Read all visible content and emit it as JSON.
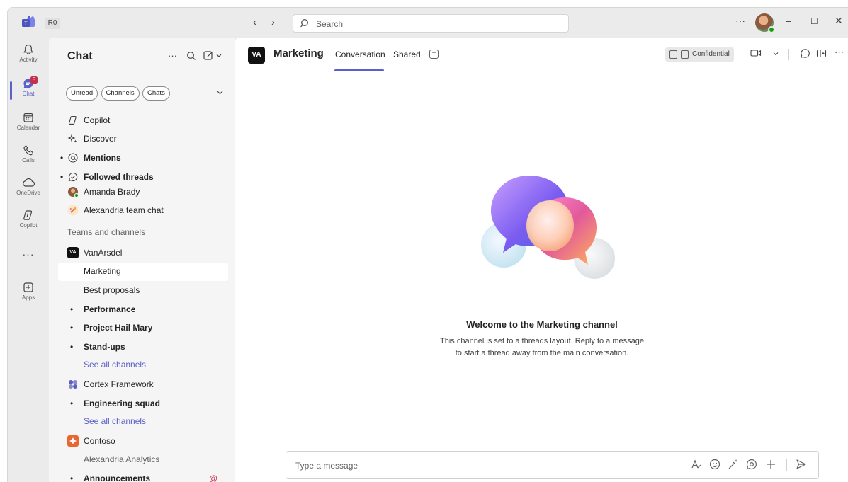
{
  "titlebar": {
    "org": "R0",
    "back": "‹",
    "forward": "›",
    "search_placeholder": "Search",
    "more": "···",
    "minimize": "–",
    "maximize": "☐",
    "close": "✕"
  },
  "rail": {
    "items": [
      {
        "label": "Activity",
        "icon": "bell-icon"
      },
      {
        "label": "Chat",
        "icon": "chat-icon",
        "badge": "5"
      },
      {
        "label": "Calendar",
        "icon": "calendar-icon"
      },
      {
        "label": "Calls",
        "icon": "phone-icon"
      },
      {
        "label": "OneDrive",
        "icon": "cloud-icon"
      },
      {
        "label": "Copilot",
        "icon": "copilot-icon"
      },
      {
        "label": "Apps",
        "icon": "apps-icon"
      }
    ],
    "more": "···"
  },
  "chat_pane": {
    "title": "Chat",
    "more": "···",
    "filters": [
      "Unread",
      "Channels",
      "Chats"
    ],
    "pinned": [
      {
        "label": "Copilot"
      },
      {
        "label": "Discover"
      },
      {
        "label": "Mentions"
      },
      {
        "label": "Followed threads"
      }
    ],
    "chats": [
      {
        "label": "Amanda Brady"
      },
      {
        "label": "Alexandria team chat"
      }
    ],
    "teams_section_label": "Teams and channels",
    "teams": [
      {
        "label": "VanArsdel",
        "logo": "VA"
      },
      {
        "label": "Marketing"
      },
      {
        "label": "Best proposals"
      },
      {
        "label": "Performance"
      },
      {
        "label": "Project Hail Mary"
      },
      {
        "label": "Stand-ups"
      },
      {
        "label": "See all channels"
      },
      {
        "label": "Cortex Framework"
      },
      {
        "label": "Engineering squad"
      },
      {
        "label": "See all channels"
      },
      {
        "label": "Contoso"
      },
      {
        "label": "Alexandria Analytics"
      },
      {
        "label": "Announcements",
        "mention": "@"
      }
    ]
  },
  "main": {
    "team_logo": "VA",
    "channel_name": "Marketing",
    "tabs": [
      "Conversation",
      "Shared"
    ],
    "sensitivity": "Confidential",
    "welcome_title": "Welcome to the Marketing channel",
    "welcome_body": "This channel is set to a threads layout. Reply to a message to start a thread away from the main conversation.",
    "composer_placeholder": "Type a message"
  },
  "colors": {
    "accent": "#5b5fc7",
    "badge": "#c4314b",
    "presence": "#13a10e"
  }
}
